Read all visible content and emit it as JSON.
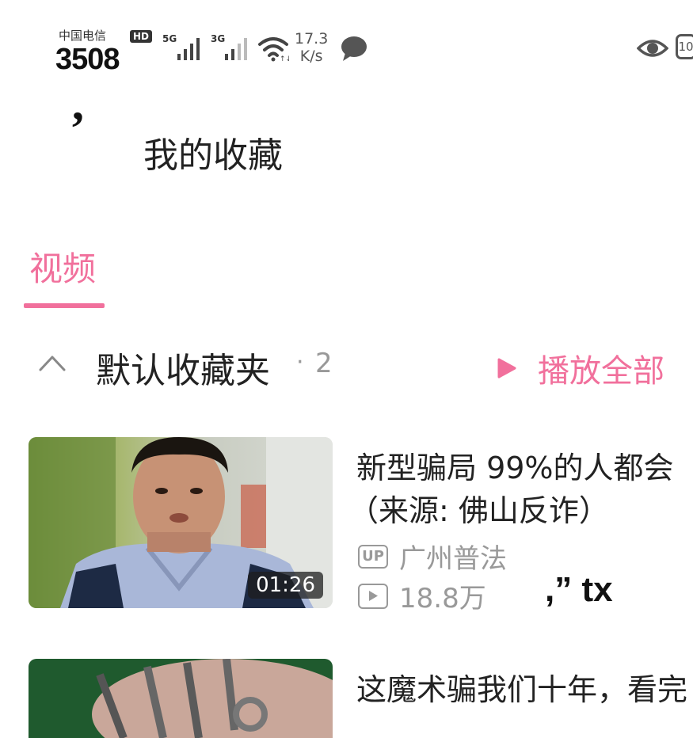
{
  "status_bar": {
    "carrier": "中国电信",
    "hd": "HD",
    "time": "3508",
    "net1": "5G",
    "net2": "3G",
    "speed_value": "17.3",
    "speed_unit": "K/s",
    "battery": "10"
  },
  "header": {
    "back_glyph": "’",
    "title": "我的收藏"
  },
  "tabs": [
    {
      "label": "视频",
      "active": true
    }
  ],
  "folder": {
    "name": "默认收藏夹",
    "separator": "·",
    "count": "2",
    "play_all_label": "播放全部"
  },
  "videos": [
    {
      "title_line1": "新型骗局 99%的人都会",
      "title_line2": "（来源: 佛山反诈）",
      "up_badge": "UP",
      "uploader": "广州普法",
      "views": "18.8万",
      "duration": "01:26"
    },
    {
      "title_line1": "这魔术骗我们十年，看完"
    }
  ],
  "overlay_text": ",” tx",
  "colors": {
    "accent": "#f1709c",
    "muted": "#999999",
    "text": "#222222"
  },
  "icons": {
    "signal": "signal-bars-icon",
    "wifi": "wifi-icon",
    "message": "message-bubble-icon",
    "eye": "eye-icon",
    "collapse": "chevron-up-icon",
    "play": "play-triangle-icon",
    "views": "play-box-icon"
  }
}
